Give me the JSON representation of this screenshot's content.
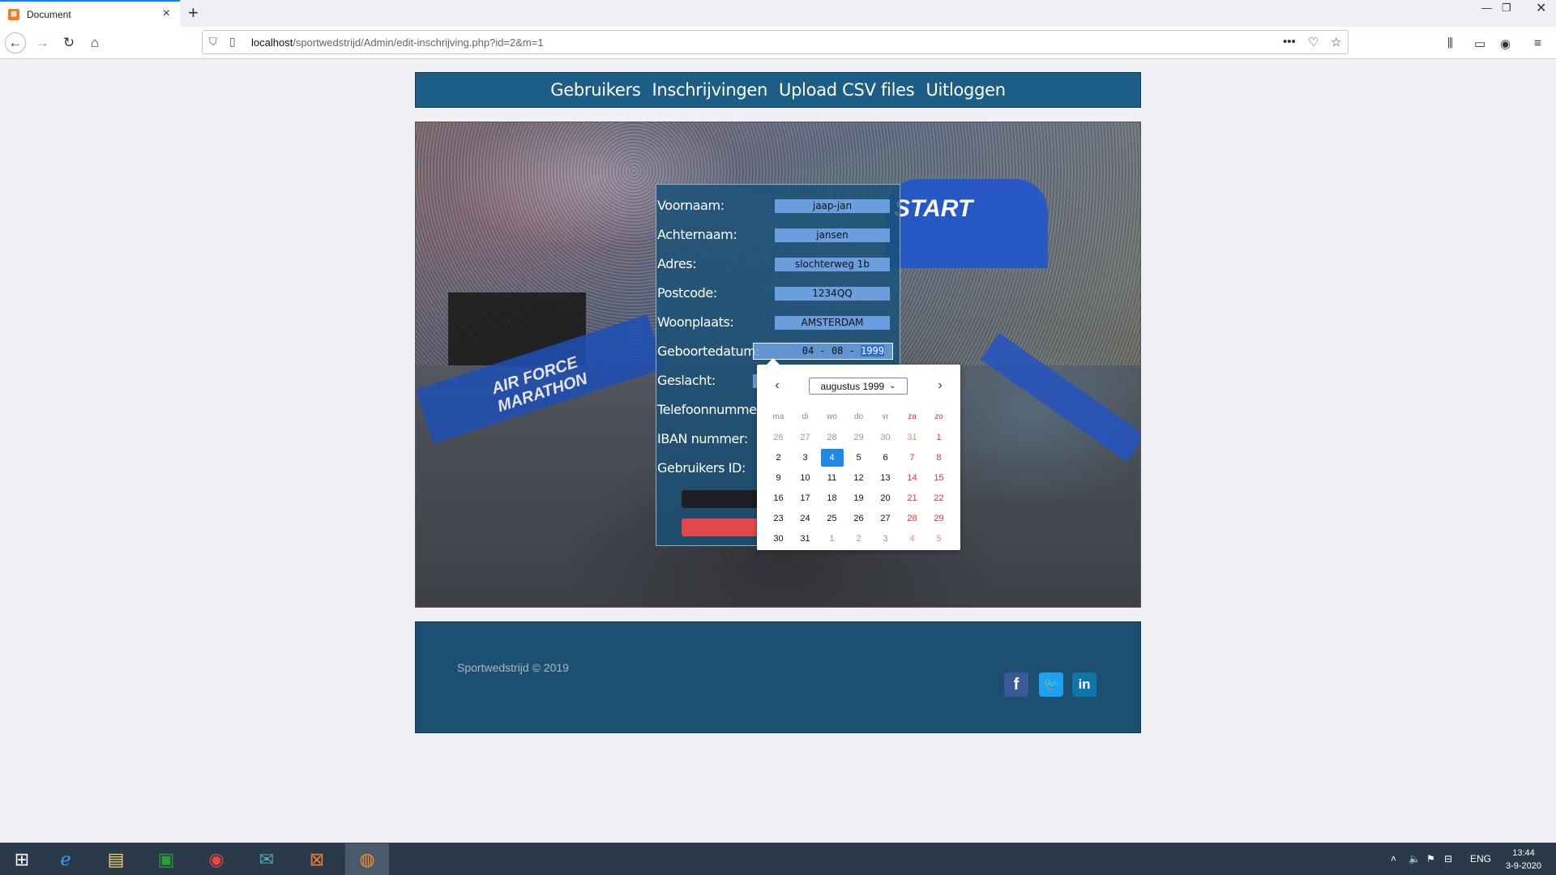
{
  "browser": {
    "tab_title": "Document",
    "url_host": "localhost",
    "url_path": "/sportwedstrijd/Admin/edit-inschrijving.php?id=2&m=1"
  },
  "nav": {
    "items": [
      "Gebruikers",
      "Inschrijvingen",
      "Upload CSV files",
      "Uitloggen"
    ]
  },
  "hero": {
    "banner_left_text": "AIR FORCE MARATHON",
    "arch_text": "START"
  },
  "form": {
    "fields": [
      {
        "label": "Voornaam:",
        "value": "jaap-jan"
      },
      {
        "label": "Achternaam:",
        "value": "jansen"
      },
      {
        "label": "Adres:",
        "value": "slochterweg 1b"
      },
      {
        "label": "Postcode:",
        "value": "1234QQ"
      },
      {
        "label": "Woonplaats:",
        "value": "AMSTERDAM"
      },
      {
        "label": "Geboortedatum:",
        "value_day": "04",
        "value_month": "08",
        "value_year": "1999"
      },
      {
        "label": "Geslacht:"
      },
      {
        "label": "Telefoonnummer"
      },
      {
        "label": "IBAN nummer:"
      },
      {
        "label": "Gebruikers ID:"
      }
    ]
  },
  "datepicker": {
    "month_label": "augustus 1999",
    "weekdays": [
      "ma",
      "di",
      "wo",
      "do",
      "vr",
      "za",
      "zo"
    ],
    "selected_day": "4",
    "weeks": [
      [
        "26",
        "27",
        "28",
        "29",
        "30",
        "31",
        "1"
      ],
      [
        "2",
        "3",
        "4",
        "5",
        "6",
        "7",
        "8"
      ],
      [
        "9",
        "10",
        "11",
        "12",
        "13",
        "14",
        "15"
      ],
      [
        "16",
        "17",
        "18",
        "19",
        "20",
        "21",
        "22"
      ],
      [
        "23",
        "24",
        "25",
        "26",
        "27",
        "28",
        "29"
      ],
      [
        "30",
        "31",
        "1",
        "2",
        "3",
        "4",
        "5"
      ]
    ]
  },
  "footer": {
    "copyright": "Sportwedstrijd © 2019",
    "social": [
      "facebook-icon",
      "twitter-icon",
      "linkedin-icon"
    ]
  },
  "taskbar": {
    "language": "ENG",
    "time": "13:44",
    "date": "3-9-2020"
  },
  "colors": {
    "nav_bg": "#1d5e87",
    "footer_bg": "#1d4f71",
    "weekend": "#dd3333",
    "selected": "#1e88e5"
  }
}
